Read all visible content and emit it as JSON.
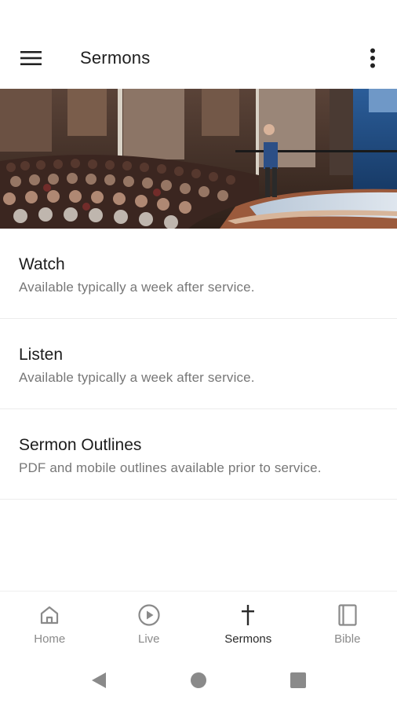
{
  "app_bar": {
    "title": "Sermons",
    "menu_icon": "hamburger-menu-icon",
    "more_icon": "more-vert-icon"
  },
  "hero": {
    "description_icon": "sanctuary-photo"
  },
  "list": {
    "items": [
      {
        "title": "Watch",
        "subtitle": "Available typically a week after service."
      },
      {
        "title": "Listen",
        "subtitle": "Available typically a week after service."
      },
      {
        "title": "Sermon Outlines",
        "subtitle": "PDF and mobile outlines available prior to service."
      }
    ]
  },
  "bottom_nav": {
    "items": [
      {
        "label": "Home",
        "icon": "home-icon"
      },
      {
        "label": "Live",
        "icon": "play-circle-icon"
      },
      {
        "label": "Sermons",
        "icon": "cross-icon",
        "active": true
      },
      {
        "label": "Bible",
        "icon": "book-icon"
      }
    ]
  },
  "colors": {
    "text_primary": "#1c1c1c",
    "text_secondary": "#777777",
    "nav_inactive": "#8a8a8a",
    "nav_active": "#2a2a2a",
    "divider": "#ececec"
  }
}
